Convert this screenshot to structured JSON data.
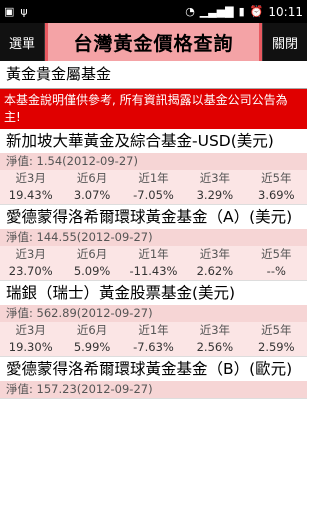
{
  "status_bar": {
    "time": "10:11"
  },
  "header": {
    "menu_label": "選單",
    "title": "台灣黃金價格查詢",
    "close_label": "關閉"
  },
  "section_title": "黃金貴金屬基金",
  "notice": "本基金說明僅供參考, 所有資訊揭露以基金公司公告為主!",
  "period_labels": [
    "近3月",
    "近6月",
    "近1年",
    "近3年",
    "近5年"
  ],
  "funds": [
    {
      "name": "新加坡大華黃金及綜合基金-USD(美元)",
      "nav": "淨值: 1.54(2012-09-27)",
      "returns": [
        "19.43%",
        "3.07%",
        "-7.05%",
        "3.29%",
        "3.69%"
      ]
    },
    {
      "name": "愛德蒙得洛希爾環球黃金基金（A）(美元)",
      "nav": "淨值: 144.55(2012-09-27)",
      "returns": [
        "23.70%",
        "5.09%",
        "-11.43%",
        "2.62%",
        "--%"
      ]
    },
    {
      "name": "瑞銀（瑞士）黃金股票基金(美元)",
      "nav": "淨值: 562.89(2012-09-27)",
      "returns": [
        "19.30%",
        "5.99%",
        "-7.63%",
        "2.56%",
        "2.59%"
      ]
    },
    {
      "name": "愛德蒙得洛希爾環球黃金基金（B）(歐元)",
      "nav": "淨值: 157.23(2012-09-27)",
      "returns": []
    }
  ]
}
